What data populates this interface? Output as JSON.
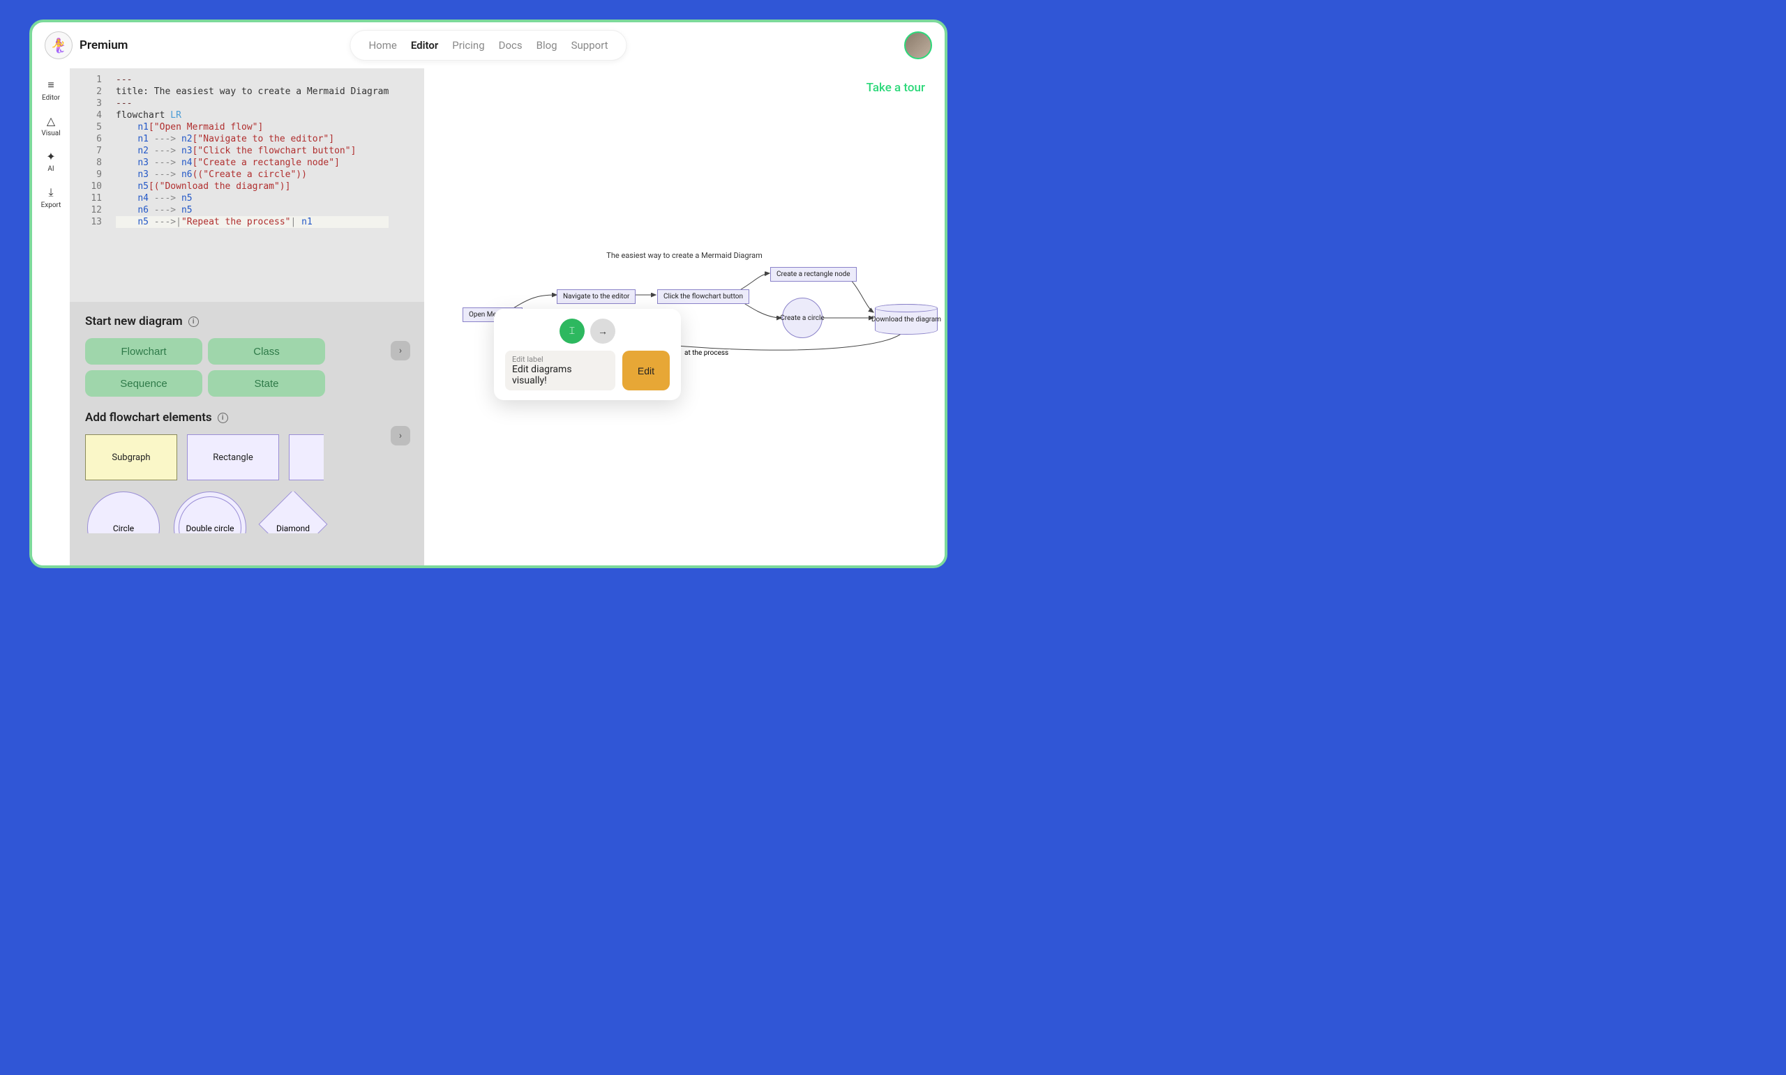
{
  "header": {
    "brand": "Premium",
    "nav": [
      "Home",
      "Editor",
      "Pricing",
      "Docs",
      "Blog",
      "Support"
    ],
    "active_nav": "Editor"
  },
  "sidebar": {
    "items": [
      {
        "icon": "≡",
        "label": "Editor"
      },
      {
        "icon": "△",
        "label": "Visual"
      },
      {
        "icon": "✦",
        "label": "AI"
      },
      {
        "icon": "⤓",
        "label": "Export"
      }
    ]
  },
  "code": {
    "line_numbers": [
      "1",
      "2",
      "3",
      "4",
      "5",
      "6",
      "7",
      "8",
      "9",
      "10",
      "11",
      "12",
      "13"
    ],
    "lines": [
      [
        {
          "c": "tk-d",
          "t": "---"
        }
      ],
      [
        {
          "c": "tk-k",
          "t": "title: The easiest way to create a Mermaid Diagram"
        }
      ],
      [
        {
          "c": "tk-d",
          "t": "---"
        }
      ],
      [
        {
          "c": "tk-k",
          "t": "flowchart "
        },
        {
          "c": "tk-t",
          "t": "LR"
        }
      ],
      [
        {
          "c": "",
          "t": "    "
        },
        {
          "c": "tk-n",
          "t": "n1"
        },
        {
          "c": "tk-s",
          "t": "[\"Open Mermaid flow\"]"
        }
      ],
      [
        {
          "c": "",
          "t": "    "
        },
        {
          "c": "tk-n",
          "t": "n1"
        },
        {
          "c": "tk-o",
          "t": " ---> "
        },
        {
          "c": "tk-n",
          "t": "n2"
        },
        {
          "c": "tk-s",
          "t": "[\"Navigate to the editor\"]"
        }
      ],
      [
        {
          "c": "",
          "t": "    "
        },
        {
          "c": "tk-n",
          "t": "n2"
        },
        {
          "c": "tk-o",
          "t": " ---> "
        },
        {
          "c": "tk-n",
          "t": "n3"
        },
        {
          "c": "tk-s",
          "t": "[\"Click the flowchart button\"]"
        }
      ],
      [
        {
          "c": "",
          "t": "    "
        },
        {
          "c": "tk-n",
          "t": "n3"
        },
        {
          "c": "tk-o",
          "t": " ---> "
        },
        {
          "c": "tk-n",
          "t": "n4"
        },
        {
          "c": "tk-s",
          "t": "[\"Create a rectangle node\"]"
        }
      ],
      [
        {
          "c": "",
          "t": "    "
        },
        {
          "c": "tk-n",
          "t": "n3"
        },
        {
          "c": "tk-o",
          "t": " ---> "
        },
        {
          "c": "tk-n",
          "t": "n6"
        },
        {
          "c": "tk-s",
          "t": "((\"Create a circle\"))"
        }
      ],
      [
        {
          "c": "",
          "t": "    "
        },
        {
          "c": "tk-n",
          "t": "n5"
        },
        {
          "c": "tk-s",
          "t": "[(\"Download the diagram\")]"
        }
      ],
      [
        {
          "c": "",
          "t": "    "
        },
        {
          "c": "tk-n",
          "t": "n4"
        },
        {
          "c": "tk-o",
          "t": " ---> "
        },
        {
          "c": "tk-n",
          "t": "n5"
        }
      ],
      [
        {
          "c": "",
          "t": "    "
        },
        {
          "c": "tk-n",
          "t": "n6"
        },
        {
          "c": "tk-o",
          "t": " ---> "
        },
        {
          "c": "tk-n",
          "t": "n5"
        }
      ],
      [
        {
          "c": "",
          "t": "    "
        },
        {
          "c": "tk-n",
          "t": "n5"
        },
        {
          "c": "tk-o",
          "t": " --->|"
        },
        {
          "c": "tk-s",
          "t": "\"Repeat the process\""
        },
        {
          "c": "tk-o",
          "t": "| "
        },
        {
          "c": "tk-n",
          "t": "n1"
        }
      ]
    ]
  },
  "tools": {
    "start_title": "Start new diagram",
    "diagram_buttons": [
      "Flowchart",
      "Class",
      "Sequence",
      "State"
    ],
    "elements_title": "Add flowchart elements",
    "shapes": {
      "subgraph": "Subgraph",
      "rectangle": "Rectangle",
      "circle": "Circle",
      "double_circle": "Double circle",
      "diamond": "Diamond"
    }
  },
  "canvas": {
    "tour": "Take a tour",
    "title": "The easiest way to create a Mermaid Diagram",
    "nodes": {
      "n1": "Open Mermai...",
      "n2": "Navigate to the editor",
      "n3": "Click the flowchart button",
      "n4": "Create a rectangle node",
      "n6": "Create a circle",
      "n5": "Download the diagram"
    },
    "edge_label": "at the process"
  },
  "popup": {
    "field_label": "Edit label",
    "field_value": "Edit diagrams visually!",
    "button": "Edit"
  }
}
